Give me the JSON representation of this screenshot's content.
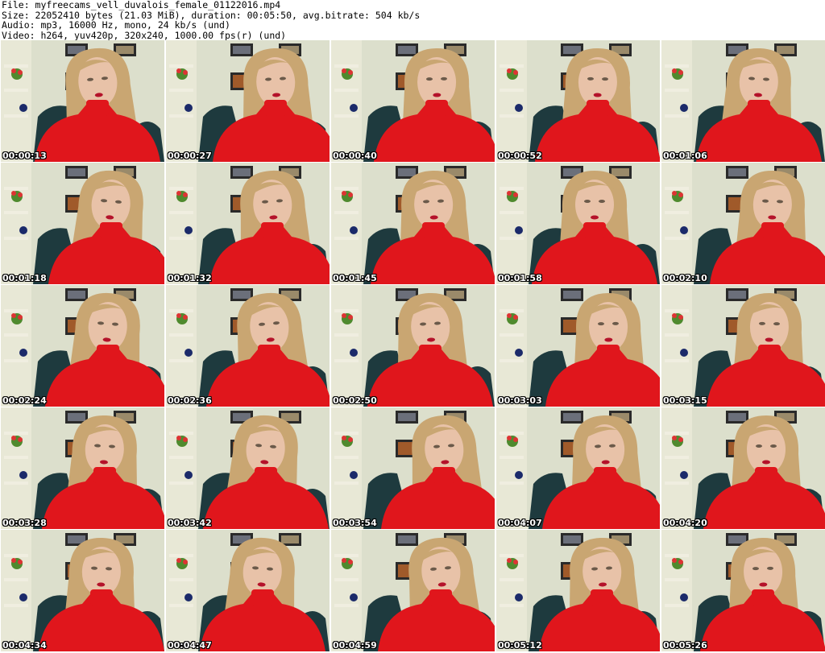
{
  "header": {
    "file_line": "File: myfreecams_vell_duvalois_female_01122016.mp4",
    "size_line": "Size: 22052410 bytes (21.03 MiB), duration: 00:05:50, avg.bitrate: 504 kb/s",
    "audio_line": "Audio: mp3, 16000 Hz, mono, 24 kb/s (und)",
    "video_line": "Video: h264, yuv420p, 320x240, 1000.00 fps(r) (und)"
  },
  "colors": {
    "wall": "#dcdfcc",
    "sweater": "#e0161c",
    "hair": "#c9a672",
    "skin": "#e8c2a8",
    "chair": "#1e3a3e",
    "frame": "#2a2a2a",
    "shelf": "#f0eee0"
  },
  "thumbnails": [
    {
      "time": "00:00:13"
    },
    {
      "time": "00:00:27"
    },
    {
      "time": "00:00:40"
    },
    {
      "time": "00:00:52"
    },
    {
      "time": "00:01:06"
    },
    {
      "time": "00:01:18"
    },
    {
      "time": "00:01:32"
    },
    {
      "time": "00:01:45"
    },
    {
      "time": "00:01:58"
    },
    {
      "time": "00:02:10"
    },
    {
      "time": "00:02:24"
    },
    {
      "time": "00:02:36"
    },
    {
      "time": "00:02:50"
    },
    {
      "time": "00:03:03"
    },
    {
      "time": "00:03:15"
    },
    {
      "time": "00:03:28"
    },
    {
      "time": "00:03:42"
    },
    {
      "time": "00:03:54"
    },
    {
      "time": "00:04:07"
    },
    {
      "time": "00:04:20"
    },
    {
      "time": "00:04:34"
    },
    {
      "time": "00:04:47"
    },
    {
      "time": "00:04:59"
    },
    {
      "time": "00:05:12"
    },
    {
      "time": "00:05:26"
    }
  ]
}
